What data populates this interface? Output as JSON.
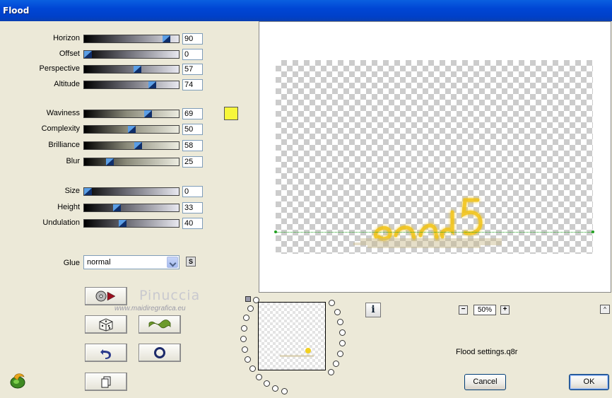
{
  "window": {
    "title": "Flood"
  },
  "params_group1": [
    {
      "label": "Horizon",
      "value": "90",
      "slider_percent": 90,
      "track": "gray"
    },
    {
      "label": "Offset",
      "value": "0",
      "slider_percent": 0,
      "track": "gray"
    },
    {
      "label": "Perspective",
      "value": "57",
      "slider_percent": 57,
      "track": "gray"
    },
    {
      "label": "Altitude",
      "value": "74",
      "slider_percent": 74,
      "track": "gray"
    }
  ],
  "params_group2": [
    {
      "label": "Waviness",
      "value": "69",
      "slider_percent": 69,
      "track": "sand"
    },
    {
      "label": "Complexity",
      "value": "50",
      "slider_percent": 50,
      "track": "sand"
    },
    {
      "label": "Brilliance",
      "value": "58",
      "slider_percent": 58,
      "track": "sand"
    },
    {
      "label": "Blur",
      "value": "25",
      "slider_percent": 25,
      "track": "sand"
    }
  ],
  "params_group3": [
    {
      "label": "Size",
      "value": "0",
      "slider_percent": 0,
      "track": "gray"
    },
    {
      "label": "Height",
      "value": "33",
      "slider_percent": 33,
      "track": "gray"
    },
    {
      "label": "Undulation",
      "value": "40",
      "slider_percent": 40,
      "track": "gray"
    }
  ],
  "color_swatch": "#f7f73b",
  "glue": {
    "label": "Glue",
    "value": "normal",
    "s_label": "S"
  },
  "watermark": {
    "line1": "Pinuccia",
    "line2": "www.maidiregrafica.eu"
  },
  "tool_buttons": [
    {
      "name": "random-generator-button",
      "icon": "disc-play-icon"
    },
    {
      "name": "dice-button",
      "icon": "dice-icon"
    },
    {
      "name": "wave-button",
      "icon": "wave-icon"
    },
    {
      "name": "undo-button",
      "icon": "undo-arrow-icon"
    },
    {
      "name": "reset-button",
      "icon": "circle-reset-icon"
    },
    {
      "name": "copy-button",
      "icon": "copy-icon"
    }
  ],
  "preview": {
    "zoom": "50%",
    "zoom_minus": "−",
    "zoom_plus": "+",
    "up_label": "^"
  },
  "info": {
    "label": "i"
  },
  "settings_file": "Flood settings.q8r",
  "buttons": {
    "cancel": "Cancel",
    "ok": "OK"
  }
}
